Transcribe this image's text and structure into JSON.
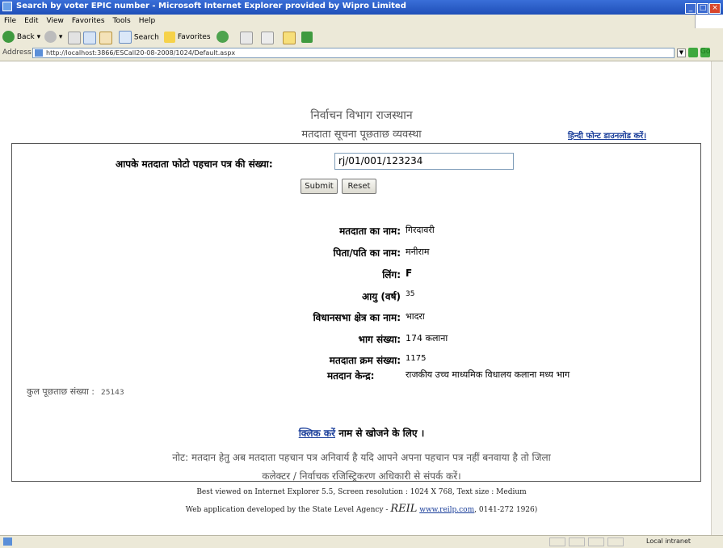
{
  "window": {
    "title": "Search by voter EPIC number - Microsoft Internet Explorer provided by Wipro Limited"
  },
  "menu": [
    "File",
    "Edit",
    "View",
    "Favorites",
    "Tools",
    "Help"
  ],
  "toolbar": {
    "back_label": "Back",
    "search_label": "Search",
    "favorites_label": "Favorites"
  },
  "address": {
    "label": "Address",
    "url": "http://localhost:3866/ESCall20-08-2008/1024/Default.aspx",
    "go_label": "Go"
  },
  "header": {
    "line1": "निर्वाचन विभाग राजस्थान",
    "line2": "मतदाता सूचना पूछताछ व्यवस्था",
    "hindi_font_link": "हिन्दी फोन्ट डाउनलोड करें।"
  },
  "form": {
    "epic_label": "आपके मतदाता फोटो पहचान पत्र की संख्या:",
    "epic_value": "rj/01/001/123234",
    "submit_label": "Submit",
    "reset_label": "Reset"
  },
  "result": {
    "voter_name_label": "मतदाता का नाम:",
    "voter_name_value": "गिरदावरी",
    "father_label": "पिता/पति का नाम:",
    "father_value": "मनीराम",
    "gender_label": "लिंग:",
    "gender_value": "F",
    "age_label": "आयु (वर्ष)",
    "age_value": "35",
    "assembly_label": "विधानसभा क्षेत्र का नाम:",
    "assembly_value": "भादरा",
    "part_label": "भाग संख्या:",
    "part_value": "174 कलाना",
    "serial_label": "मतदाता क्रम संख्या:",
    "serial_value": "1175",
    "booth_label": "मतदान केन्द्र:",
    "booth_value": "राजकीय उच्च माध्यमिक विधालय कलाना मध्य भाग"
  },
  "footer": {
    "total_label": "कुल पूछताछ संख्या :",
    "total_value": "25143",
    "click_link": "क्लिक करें",
    "click_text": "नाम से खोजने के लिए ।",
    "note_line1": "नोट: मतदान हेतु अब मतदाता पहचान पत्र अनिवार्य है यदि आपने अपना पहचान पत्र नहीं बनवाया है तो जिला",
    "note_line2": "कलेक्टर / निर्वाचक रजिस्ट्रिकरण अधिकारी से संपर्क करें।",
    "best_viewed": "Best viewed on Internet Explorer 5.5, Screen resolution : 1024 X 768, Text size : Medium",
    "developed_prefix": "Web application developed by the State Level Agency -",
    "developed_brand": "REIL",
    "developed_url": "www.reilp.com",
    "developed_phone": ", 0141-272 1926)"
  },
  "status": {
    "zone": "Local intranet"
  },
  "colors": {
    "titlebar": "#1f4fb8",
    "link": "#1a3e9a",
    "chrome": "#ece9d8"
  }
}
